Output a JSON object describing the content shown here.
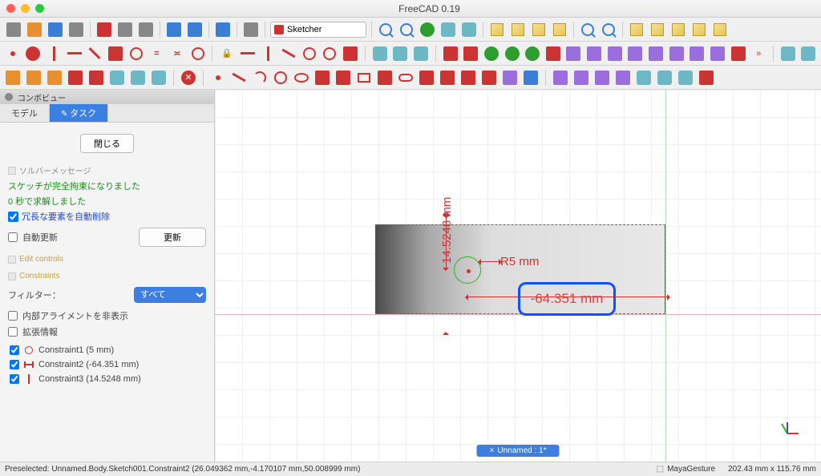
{
  "app": {
    "title": "FreeCAD 0.19"
  },
  "workbench": {
    "selected": "Sketcher"
  },
  "panel": {
    "title": "コンボビュー",
    "tabs": {
      "model": "モデル",
      "task": "タスク"
    },
    "close_label": "閉じる",
    "solver_section": "ソルバーメッセージ",
    "msg_fully": "スケッチが完全拘束になりました",
    "msg_solved": "0 秒で求解しました",
    "auto_remove": "冗長な要素を自動削除",
    "auto_update": "自動更新",
    "update_btn": "更新",
    "edit_section": "Edit controls",
    "constraints_section": "Constraints",
    "filter_label": "フィルター：",
    "filter_all": "すべて",
    "hide_internal": "内部アライメントを非表示",
    "extended_info": "拡張情報",
    "constraints": [
      {
        "icon": "radius",
        "label": "Constraint1 (5 mm)"
      },
      {
        "icon": "hdist",
        "label": "Constraint2 (-64.351 mm)"
      },
      {
        "icon": "vdist",
        "label": "Constraint3 (14.5248 mm)"
      }
    ]
  },
  "viewport": {
    "r_label": "R5 mm",
    "v_label": "14.5248 mm",
    "sel_label": "-64.351 mm",
    "tab_label": "Unnamed : 1*"
  },
  "status": {
    "preselected": "Preselected: Unnamed.Body.Sketch001.Constraint2 (26.049362 mm,-4.170107 mm,50.008999 mm)",
    "nav": "MayaGesture",
    "dims": "202.43 mm x 115.76 mm"
  },
  "chart_data": {
    "type": "sketch",
    "constraints": [
      {
        "name": "Constraint1",
        "kind": "radius",
        "value_mm": 5
      },
      {
        "name": "Constraint2",
        "kind": "horizontal-distance",
        "value_mm": -64.351
      },
      {
        "name": "Constraint3",
        "kind": "vertical-distance",
        "value_mm": 14.5248
      }
    ]
  }
}
